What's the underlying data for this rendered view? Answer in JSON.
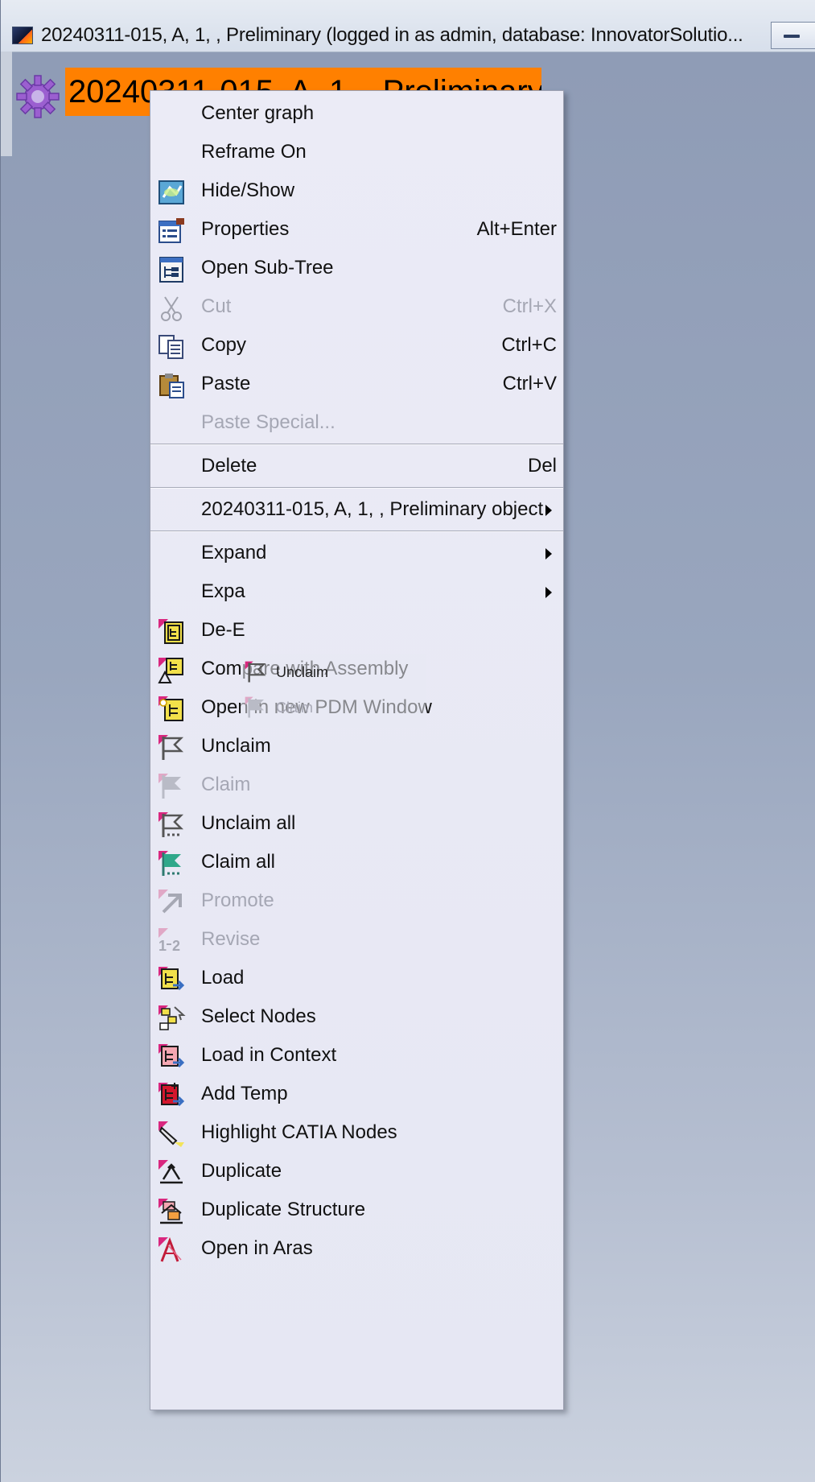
{
  "window": {
    "title": "20240311-015, A, 1, , Preliminary (logged in as admin, database: InnovatorSolutio...",
    "minimize_icon": "minimize-icon"
  },
  "node": {
    "label": "20240311-015, A, 1, , Preliminary",
    "icon": "gear-icon",
    "highlight_color": "#ff8000"
  },
  "menu": {
    "items": [
      {
        "label": "Center graph",
        "shortcut": "",
        "icon": "",
        "disabled": false
      },
      {
        "label": "Reframe On",
        "shortcut": "",
        "icon": "",
        "disabled": false
      },
      {
        "label": "Hide/Show",
        "shortcut": "",
        "icon": "hide-show-icon",
        "disabled": false
      },
      {
        "label": "Properties",
        "shortcut": "Alt+Enter",
        "icon": "properties-icon",
        "disabled": false
      },
      {
        "label": "Open Sub-Tree",
        "shortcut": "",
        "icon": "sub-tree-icon",
        "disabled": false
      },
      {
        "label": "Cut",
        "shortcut": "Ctrl+X",
        "icon": "scissors-icon",
        "disabled": true
      },
      {
        "label": "Copy",
        "shortcut": "Ctrl+C",
        "icon": "copy-icon",
        "disabled": false
      },
      {
        "label": "Paste",
        "shortcut": "Ctrl+V",
        "icon": "paste-icon",
        "disabled": false
      },
      {
        "label": "Paste Special...",
        "shortcut": "",
        "icon": "",
        "disabled": true
      },
      {
        "label": "Delete",
        "shortcut": "Del",
        "icon": "",
        "disabled": false
      },
      {
        "label": "20240311-015, A, 1, , Preliminary object",
        "shortcut": "",
        "icon": "",
        "disabled": false,
        "submenu": true
      },
      {
        "label": "Expand",
        "shortcut": "",
        "icon": "",
        "disabled": false,
        "submenu": true
      },
      {
        "label": "Expa",
        "shortcut": "",
        "icon": "",
        "disabled": false,
        "submenu": true
      },
      {
        "label": "De-E",
        "shortcut": "",
        "icon": "de-expand-icon",
        "disabled": false
      },
      {
        "label": "Compare with Assembly",
        "shortcut": "",
        "icon": "compare-assembly-icon",
        "disabled": false
      },
      {
        "label": "Open in new PDM Window",
        "shortcut": "",
        "icon": "pdm-window-icon",
        "disabled": false
      },
      {
        "label": "Unclaim",
        "shortcut": "",
        "icon": "unclaim-flag-icon",
        "disabled": false
      },
      {
        "label": "Claim",
        "shortcut": "",
        "icon": "claim-flag-icon",
        "disabled": true
      },
      {
        "label": "Unclaim all",
        "shortcut": "",
        "icon": "unclaim-all-flag-icon",
        "disabled": false
      },
      {
        "label": "Claim all",
        "shortcut": "",
        "icon": "claim-all-flag-icon",
        "disabled": false
      },
      {
        "label": "Promote",
        "shortcut": "",
        "icon": "promote-arrow-icon",
        "disabled": true
      },
      {
        "label": "Revise",
        "shortcut": "",
        "icon": "revise-icon",
        "disabled": true
      },
      {
        "label": "Load",
        "shortcut": "",
        "icon": "load-icon",
        "disabled": false
      },
      {
        "label": "Select Nodes",
        "shortcut": "",
        "icon": "select-nodes-icon",
        "disabled": false
      },
      {
        "label": "Load in Context",
        "shortcut": "",
        "icon": "load-context-icon",
        "disabled": false
      },
      {
        "label": "Add Temp",
        "shortcut": "",
        "icon": "add-temp-icon",
        "disabled": false
      },
      {
        "label": "Highlight CATIA Nodes",
        "shortcut": "",
        "icon": "highlighter-icon",
        "disabled": false
      },
      {
        "label": "Duplicate",
        "shortcut": "",
        "icon": "duplicate-icon",
        "disabled": false
      },
      {
        "label": "Duplicate Structure",
        "shortcut": "",
        "icon": "duplicate-structure-icon",
        "disabled": false
      },
      {
        "label": "Open in Aras",
        "shortcut": "",
        "icon": "aras-icon",
        "disabled": false
      }
    ],
    "ghost_submenu": [
      {
        "label": "Unclaim",
        "icon": "unclaim-flag-icon",
        "disabled": false
      },
      {
        "label": "Claim",
        "icon": "claim-flag-icon",
        "disabled": true
      }
    ]
  },
  "colors": {
    "background": "#99a6be",
    "menu_background": "#e8e9f4",
    "disabled_text": "#a5a7b4",
    "accent_magenta": "#d9277f"
  }
}
